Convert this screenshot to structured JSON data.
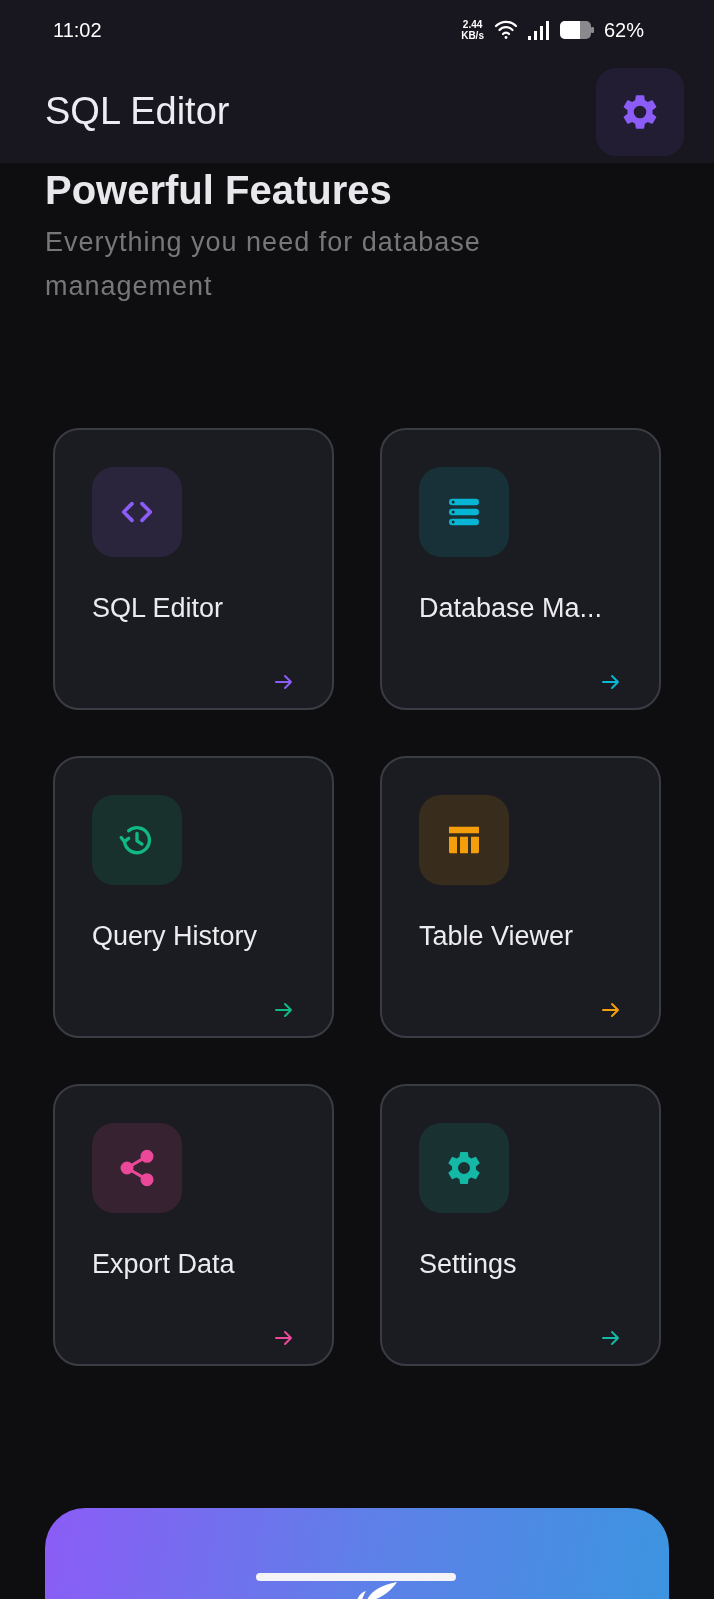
{
  "status_bar": {
    "time": "11:02",
    "speed_value": "2.44",
    "speed_unit": "KB/s",
    "battery": "62%"
  },
  "app_bar": {
    "title": "SQL Editor"
  },
  "section": {
    "title": "Powerful Features",
    "subtitle": "Everything you need for database management"
  },
  "features": [
    {
      "title": "SQL Editor",
      "kind": "code",
      "color": "#8b5cf6"
    },
    {
      "title": "Database Ma...",
      "kind": "database",
      "color": "#06b6d4"
    },
    {
      "title": "Query History",
      "kind": "history",
      "color": "#10b981"
    },
    {
      "title": "Table Viewer",
      "kind": "table",
      "color": "#f59e0b"
    },
    {
      "title": "Export Data",
      "kind": "share",
      "color": "#ec4899"
    },
    {
      "title": "Settings",
      "kind": "gear",
      "color": "#14b8a6"
    }
  ]
}
